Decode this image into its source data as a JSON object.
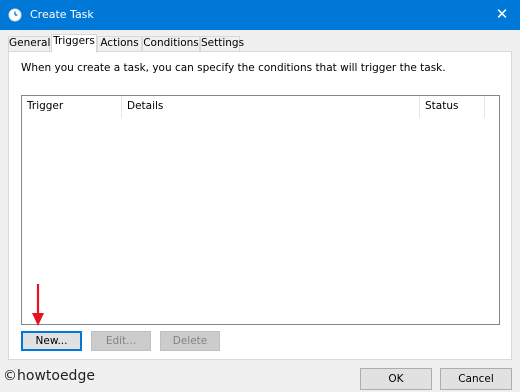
{
  "window": {
    "title": "Create Task",
    "close_glyph": "✕",
    "icon": "clock-icon"
  },
  "tabs": [
    {
      "label": "General",
      "active": false
    },
    {
      "label": "Triggers",
      "active": true
    },
    {
      "label": "Actions",
      "active": false
    },
    {
      "label": "Conditions",
      "active": false
    },
    {
      "label": "Settings",
      "active": false
    }
  ],
  "triggers_panel": {
    "info_text": "When you create a task, you can specify the conditions that will trigger the task.",
    "columns": [
      "Trigger",
      "Details",
      "Status"
    ],
    "rows": []
  },
  "buttons": {
    "new": "New...",
    "edit": "Edit...",
    "delete": "Delete"
  },
  "footer": {
    "ok": "OK",
    "cancel": "Cancel"
  },
  "watermark": "©howtoedge",
  "colors": {
    "titlebar": "#0078d7",
    "arrow": "#e81123"
  }
}
